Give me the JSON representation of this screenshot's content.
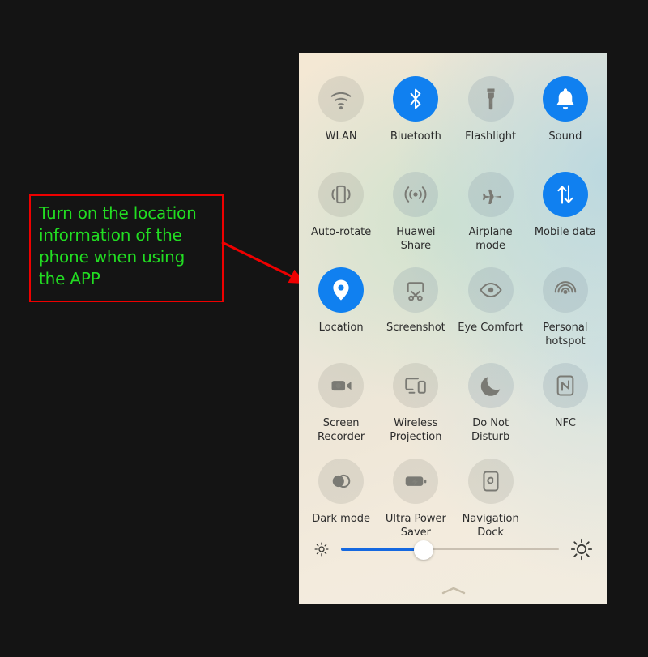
{
  "annotation": {
    "text": "Turn on the location information of the phone when using the APP",
    "text_color": "#22dd22",
    "border_color": "#ee0000",
    "arrow_color": "#ee0000",
    "arrow_target": "location-tile"
  },
  "panel": {
    "accent_color": "#1080f0",
    "background_colors": [
      "#f4e8d4",
      "#cee2cd",
      "#bad8e0",
      "#f2ece0"
    ],
    "tiles": [
      {
        "label": "WLAN",
        "icon": "wifi-icon",
        "active": false,
        "tint": false
      },
      {
        "label": "Bluetooth",
        "icon": "bluetooth-icon",
        "active": true,
        "tint": false
      },
      {
        "label": "Flashlight",
        "icon": "flashlight-icon",
        "active": false,
        "tint": true
      },
      {
        "label": "Sound",
        "icon": "bell-icon",
        "active": true,
        "tint": false
      },
      {
        "label": "Auto-rotate",
        "icon": "auto-rotate-icon",
        "active": false,
        "tint": false
      },
      {
        "label": "Huawei Share",
        "icon": "huawei-share-icon",
        "active": false,
        "tint": true
      },
      {
        "label": "Airplane mode",
        "icon": "airplane-icon",
        "active": false,
        "tint": true
      },
      {
        "label": "Mobile data",
        "icon": "mobile-data-icon",
        "active": true,
        "tint": false
      },
      {
        "label": "Location",
        "icon": "location-pin-icon",
        "active": true,
        "tint": false
      },
      {
        "label": "Screenshot",
        "icon": "screenshot-icon",
        "active": false,
        "tint": true
      },
      {
        "label": "Eye Comfort",
        "icon": "eye-icon",
        "active": false,
        "tint": true
      },
      {
        "label": "Personal hotspot",
        "icon": "hotspot-icon",
        "active": false,
        "tint": true
      },
      {
        "label": "Screen Recorder",
        "icon": "screen-recorder-icon",
        "active": false,
        "tint": false
      },
      {
        "label": "Wireless Projection",
        "icon": "wireless-projection-icon",
        "active": false,
        "tint": false
      },
      {
        "label": "Do Not Disturb",
        "icon": "moon-icon",
        "active": false,
        "tint": true
      },
      {
        "label": "NFC",
        "icon": "nfc-icon",
        "active": false,
        "tint": true
      },
      {
        "label": "Dark mode",
        "icon": "dark-mode-icon",
        "active": false,
        "tint": false
      },
      {
        "label": "Ultra Power Saver",
        "icon": "battery-saver-icon",
        "active": false,
        "tint": false
      },
      {
        "label": "Navigation Dock",
        "icon": "navigation-dock-icon",
        "active": false,
        "tint": false
      }
    ],
    "brightness": {
      "value_percent": 38,
      "fill_color": "#1568e0",
      "low_icon": "sun-small-icon",
      "high_icon": "sun-large-icon"
    },
    "handle_icon": "chevron-up-icon"
  }
}
